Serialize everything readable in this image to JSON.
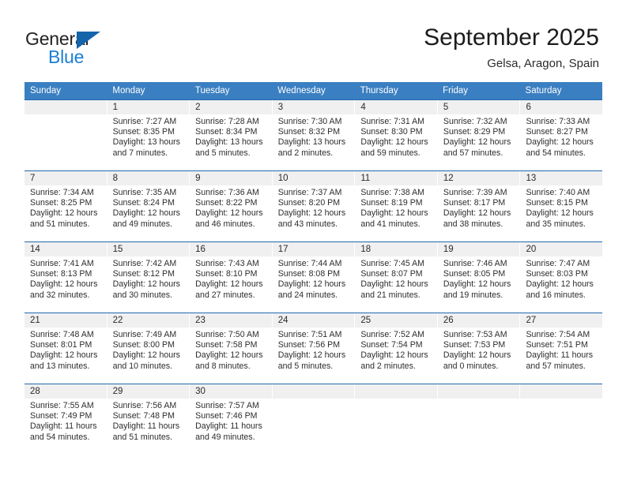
{
  "brand": {
    "name_part1": "General",
    "name_part2": "Blue",
    "triangle_color": "#1464ab",
    "blue_color": "#1a7fd4"
  },
  "header": {
    "title": "September 2025",
    "subtitle": "Gelsa, Aragon, Spain"
  },
  "theme": {
    "header_bar_color": "#3a7fc1",
    "week_separator_color": "#1f69b0",
    "daynum_band_color": "#f0f0f0",
    "text_color": "#2d2d2d"
  },
  "calendar": {
    "weekday_headers": [
      "Sunday",
      "Monday",
      "Tuesday",
      "Wednesday",
      "Thursday",
      "Friday",
      "Saturday"
    ],
    "weeks": [
      [
        {
          "day": "",
          "empty": true
        },
        {
          "day": "1",
          "sunrise": "Sunrise: 7:27 AM",
          "sunset": "Sunset: 8:35 PM",
          "daylight1": "Daylight: 13 hours",
          "daylight2": "and 7 minutes."
        },
        {
          "day": "2",
          "sunrise": "Sunrise: 7:28 AM",
          "sunset": "Sunset: 8:34 PM",
          "daylight1": "Daylight: 13 hours",
          "daylight2": "and 5 minutes."
        },
        {
          "day": "3",
          "sunrise": "Sunrise: 7:30 AM",
          "sunset": "Sunset: 8:32 PM",
          "daylight1": "Daylight: 13 hours",
          "daylight2": "and 2 minutes."
        },
        {
          "day": "4",
          "sunrise": "Sunrise: 7:31 AM",
          "sunset": "Sunset: 8:30 PM",
          "daylight1": "Daylight: 12 hours",
          "daylight2": "and 59 minutes."
        },
        {
          "day": "5",
          "sunrise": "Sunrise: 7:32 AM",
          "sunset": "Sunset: 8:29 PM",
          "daylight1": "Daylight: 12 hours",
          "daylight2": "and 57 minutes."
        },
        {
          "day": "6",
          "sunrise": "Sunrise: 7:33 AM",
          "sunset": "Sunset: 8:27 PM",
          "daylight1": "Daylight: 12 hours",
          "daylight2": "and 54 minutes."
        }
      ],
      [
        {
          "day": "7",
          "sunrise": "Sunrise: 7:34 AM",
          "sunset": "Sunset: 8:25 PM",
          "daylight1": "Daylight: 12 hours",
          "daylight2": "and 51 minutes."
        },
        {
          "day": "8",
          "sunrise": "Sunrise: 7:35 AM",
          "sunset": "Sunset: 8:24 PM",
          "daylight1": "Daylight: 12 hours",
          "daylight2": "and 49 minutes."
        },
        {
          "day": "9",
          "sunrise": "Sunrise: 7:36 AM",
          "sunset": "Sunset: 8:22 PM",
          "daylight1": "Daylight: 12 hours",
          "daylight2": "and 46 minutes."
        },
        {
          "day": "10",
          "sunrise": "Sunrise: 7:37 AM",
          "sunset": "Sunset: 8:20 PM",
          "daylight1": "Daylight: 12 hours",
          "daylight2": "and 43 minutes."
        },
        {
          "day": "11",
          "sunrise": "Sunrise: 7:38 AM",
          "sunset": "Sunset: 8:19 PM",
          "daylight1": "Daylight: 12 hours",
          "daylight2": "and 41 minutes."
        },
        {
          "day": "12",
          "sunrise": "Sunrise: 7:39 AM",
          "sunset": "Sunset: 8:17 PM",
          "daylight1": "Daylight: 12 hours",
          "daylight2": "and 38 minutes."
        },
        {
          "day": "13",
          "sunrise": "Sunrise: 7:40 AM",
          "sunset": "Sunset: 8:15 PM",
          "daylight1": "Daylight: 12 hours",
          "daylight2": "and 35 minutes."
        }
      ],
      [
        {
          "day": "14",
          "sunrise": "Sunrise: 7:41 AM",
          "sunset": "Sunset: 8:13 PM",
          "daylight1": "Daylight: 12 hours",
          "daylight2": "and 32 minutes."
        },
        {
          "day": "15",
          "sunrise": "Sunrise: 7:42 AM",
          "sunset": "Sunset: 8:12 PM",
          "daylight1": "Daylight: 12 hours",
          "daylight2": "and 30 minutes."
        },
        {
          "day": "16",
          "sunrise": "Sunrise: 7:43 AM",
          "sunset": "Sunset: 8:10 PM",
          "daylight1": "Daylight: 12 hours",
          "daylight2": "and 27 minutes."
        },
        {
          "day": "17",
          "sunrise": "Sunrise: 7:44 AM",
          "sunset": "Sunset: 8:08 PM",
          "daylight1": "Daylight: 12 hours",
          "daylight2": "and 24 minutes."
        },
        {
          "day": "18",
          "sunrise": "Sunrise: 7:45 AM",
          "sunset": "Sunset: 8:07 PM",
          "daylight1": "Daylight: 12 hours",
          "daylight2": "and 21 minutes."
        },
        {
          "day": "19",
          "sunrise": "Sunrise: 7:46 AM",
          "sunset": "Sunset: 8:05 PM",
          "daylight1": "Daylight: 12 hours",
          "daylight2": "and 19 minutes."
        },
        {
          "day": "20",
          "sunrise": "Sunrise: 7:47 AM",
          "sunset": "Sunset: 8:03 PM",
          "daylight1": "Daylight: 12 hours",
          "daylight2": "and 16 minutes."
        }
      ],
      [
        {
          "day": "21",
          "sunrise": "Sunrise: 7:48 AM",
          "sunset": "Sunset: 8:01 PM",
          "daylight1": "Daylight: 12 hours",
          "daylight2": "and 13 minutes."
        },
        {
          "day": "22",
          "sunrise": "Sunrise: 7:49 AM",
          "sunset": "Sunset: 8:00 PM",
          "daylight1": "Daylight: 12 hours",
          "daylight2": "and 10 minutes."
        },
        {
          "day": "23",
          "sunrise": "Sunrise: 7:50 AM",
          "sunset": "Sunset: 7:58 PM",
          "daylight1": "Daylight: 12 hours",
          "daylight2": "and 8 minutes."
        },
        {
          "day": "24",
          "sunrise": "Sunrise: 7:51 AM",
          "sunset": "Sunset: 7:56 PM",
          "daylight1": "Daylight: 12 hours",
          "daylight2": "and 5 minutes."
        },
        {
          "day": "25",
          "sunrise": "Sunrise: 7:52 AM",
          "sunset": "Sunset: 7:54 PM",
          "daylight1": "Daylight: 12 hours",
          "daylight2": "and 2 minutes."
        },
        {
          "day": "26",
          "sunrise": "Sunrise: 7:53 AM",
          "sunset": "Sunset: 7:53 PM",
          "daylight1": "Daylight: 12 hours",
          "daylight2": "and 0 minutes."
        },
        {
          "day": "27",
          "sunrise": "Sunrise: 7:54 AM",
          "sunset": "Sunset: 7:51 PM",
          "daylight1": "Daylight: 11 hours",
          "daylight2": "and 57 minutes."
        }
      ],
      [
        {
          "day": "28",
          "sunrise": "Sunrise: 7:55 AM",
          "sunset": "Sunset: 7:49 PM",
          "daylight1": "Daylight: 11 hours",
          "daylight2": "and 54 minutes."
        },
        {
          "day": "29",
          "sunrise": "Sunrise: 7:56 AM",
          "sunset": "Sunset: 7:48 PM",
          "daylight1": "Daylight: 11 hours",
          "daylight2": "and 51 minutes."
        },
        {
          "day": "30",
          "sunrise": "Sunrise: 7:57 AM",
          "sunset": "Sunset: 7:46 PM",
          "daylight1": "Daylight: 11 hours",
          "daylight2": "and 49 minutes."
        },
        {
          "day": "",
          "empty": true
        },
        {
          "day": "",
          "empty": true
        },
        {
          "day": "",
          "empty": true
        },
        {
          "day": "",
          "empty": true
        }
      ]
    ]
  }
}
